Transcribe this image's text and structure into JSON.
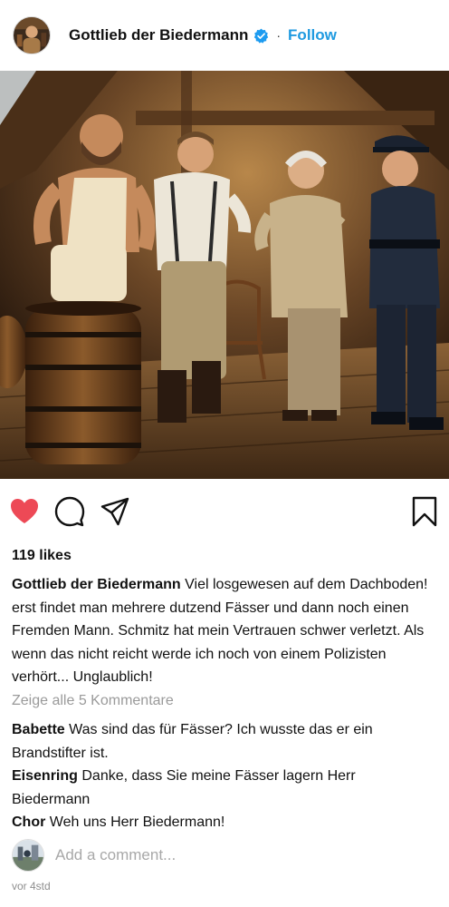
{
  "header": {
    "username": "Gottlieb der Biedermann",
    "separator": "·",
    "follow_label": "Follow",
    "avatar_icon": "profile-photo",
    "verified_icon": "verified-badge-icon"
  },
  "post": {
    "image_alt": "attic scene with barrels, four men talking"
  },
  "actions": {
    "like_icon": "heart-icon",
    "comment_icon": "comment-icon",
    "share_icon": "share-icon",
    "save_icon": "bookmark-icon",
    "like_color": "#ed4956"
  },
  "likes": "119 likes",
  "caption": {
    "author": "Gottlieb der Biedermann",
    "text": "Viel losgewesen auf dem Dachboden! erst findet man mehrere dutzend Fässer und dann noch einen Fremden Mann. Schmitz hat mein Vertrauen schwer verletzt. Als wenn das nicht reicht werde ich noch von einem Polizisten verhört... Unglaublich!"
  },
  "view_all_comments": "Zeige alle 5 Kommentare",
  "comments": [
    {
      "author": "Babette",
      "text": "Was sind das für Fässer? Ich wusste das er ein Brandstifter ist."
    },
    {
      "author": "Eisenring",
      "text": "Danke, dass Sie meine Fässer lagern Herr Biedermann"
    },
    {
      "author": "Chor",
      "text": "Weh uns Herr Biedermann!"
    }
  ],
  "add_comment": {
    "placeholder": "Add a comment..."
  },
  "timestamp": "vor 4std"
}
